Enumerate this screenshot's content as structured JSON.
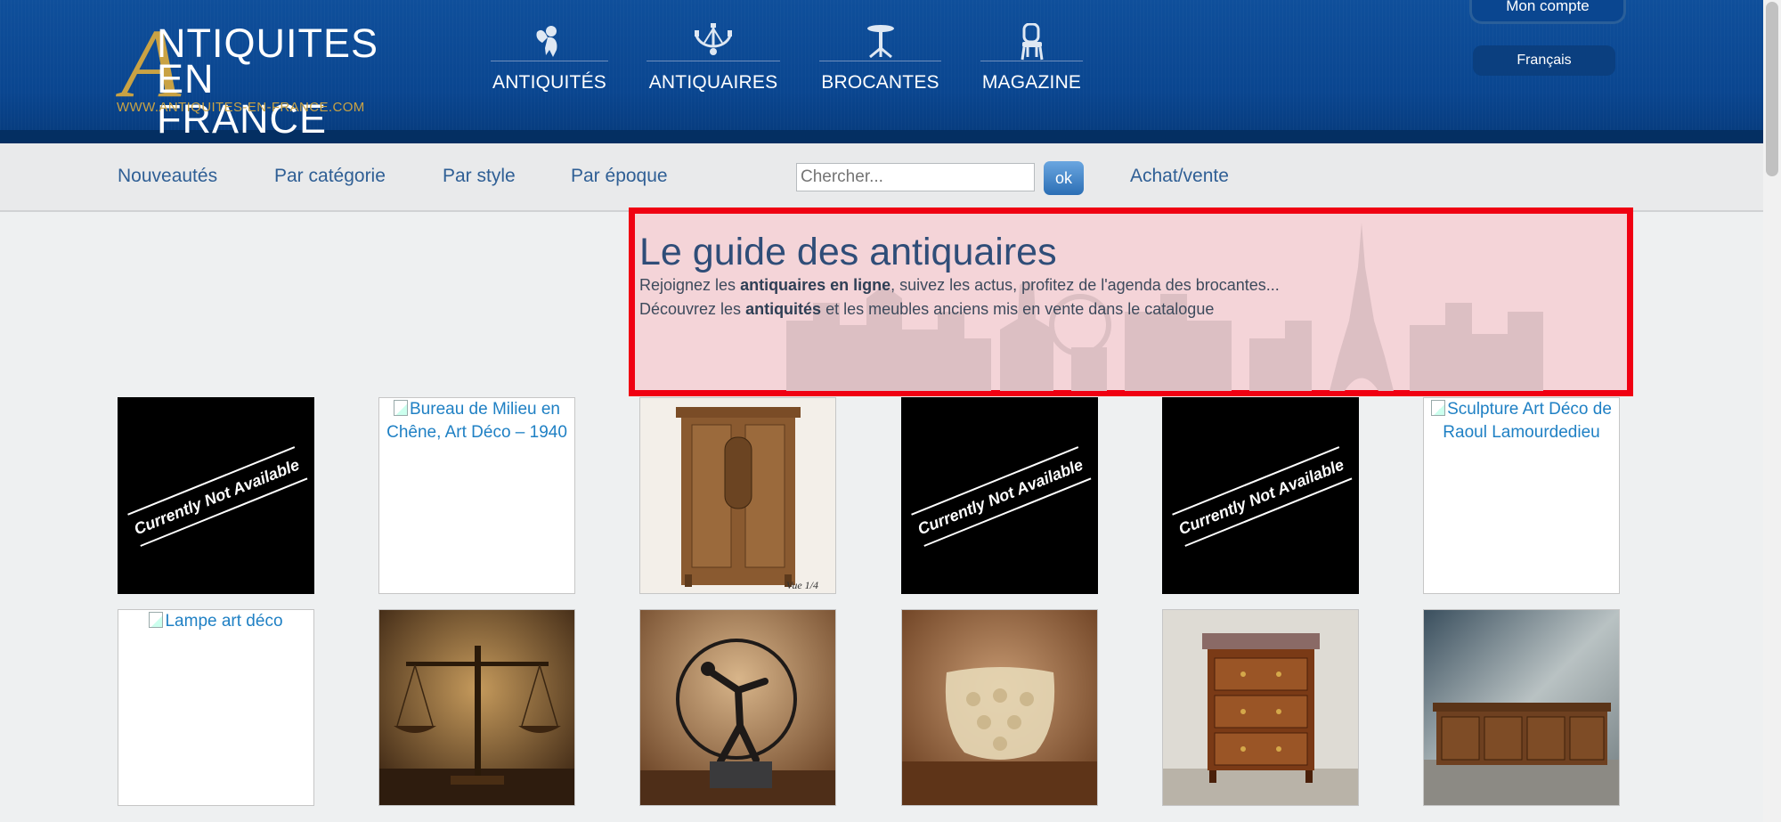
{
  "brand": {
    "initial": "A",
    "line1": "NTIQUITES",
    "line2": "EN FRANCE",
    "url": "WWW.ANTIQUITES-EN-FRANCE.COM"
  },
  "nav": [
    {
      "label": "ANTIQUITÉS",
      "icon": "cherub-icon"
    },
    {
      "label": "ANTIQUAIRES",
      "icon": "chandelier-icon"
    },
    {
      "label": "BROCANTES",
      "icon": "pedestal-table-icon"
    },
    {
      "label": "MAGAZINE",
      "icon": "chair-icon"
    }
  ],
  "account": {
    "label": "Mon compte"
  },
  "language": {
    "label": "Français"
  },
  "subnav": {
    "links": [
      "Nouveautés",
      "Par catégorie",
      "Par style",
      "Par époque"
    ],
    "search_placeholder": "Chercher...",
    "search_button": "ok",
    "buysell": "Achat/vente"
  },
  "hero": {
    "title": "Le guide des antiquaires",
    "line1": {
      "pre": "Rejoignez les ",
      "bold": "antiquaires en ligne",
      "post": ", suivez les actus, profitez de l'agenda des brocantes..."
    },
    "line2": {
      "pre": "Découvrez les ",
      "bold": "antiquités",
      "post": " et les meubles anciens mis en vente dans le catalogue"
    }
  },
  "products_row1": [
    {
      "kind": "unavailable",
      "text": "Currently Not Available"
    },
    {
      "kind": "alt",
      "alt": "Bureau de Milieu en Chêne, Art Déco – 1940"
    },
    {
      "kind": "photo",
      "subject": "cabinet",
      "caption": "Vue 1/4"
    },
    {
      "kind": "unavailable",
      "text": "Currently Not Available"
    },
    {
      "kind": "unavailable",
      "text": "Currently Not Available"
    },
    {
      "kind": "alt",
      "alt": "Sculpture Art Déco de Raoul Lamourdedieu"
    }
  ],
  "products_row2": [
    {
      "kind": "alt",
      "alt": "Lampe art déco"
    },
    {
      "kind": "photo",
      "subject": "scales"
    },
    {
      "kind": "photo",
      "subject": "bronze-statue"
    },
    {
      "kind": "photo",
      "subject": "glass-vase"
    },
    {
      "kind": "photo",
      "subject": "commode"
    },
    {
      "kind": "photo",
      "subject": "sideboard"
    }
  ],
  "colors": {
    "header": "#0a4690",
    "gold": "#c9a244",
    "link": "#2f5f95",
    "highlight_border": "#f00012"
  }
}
